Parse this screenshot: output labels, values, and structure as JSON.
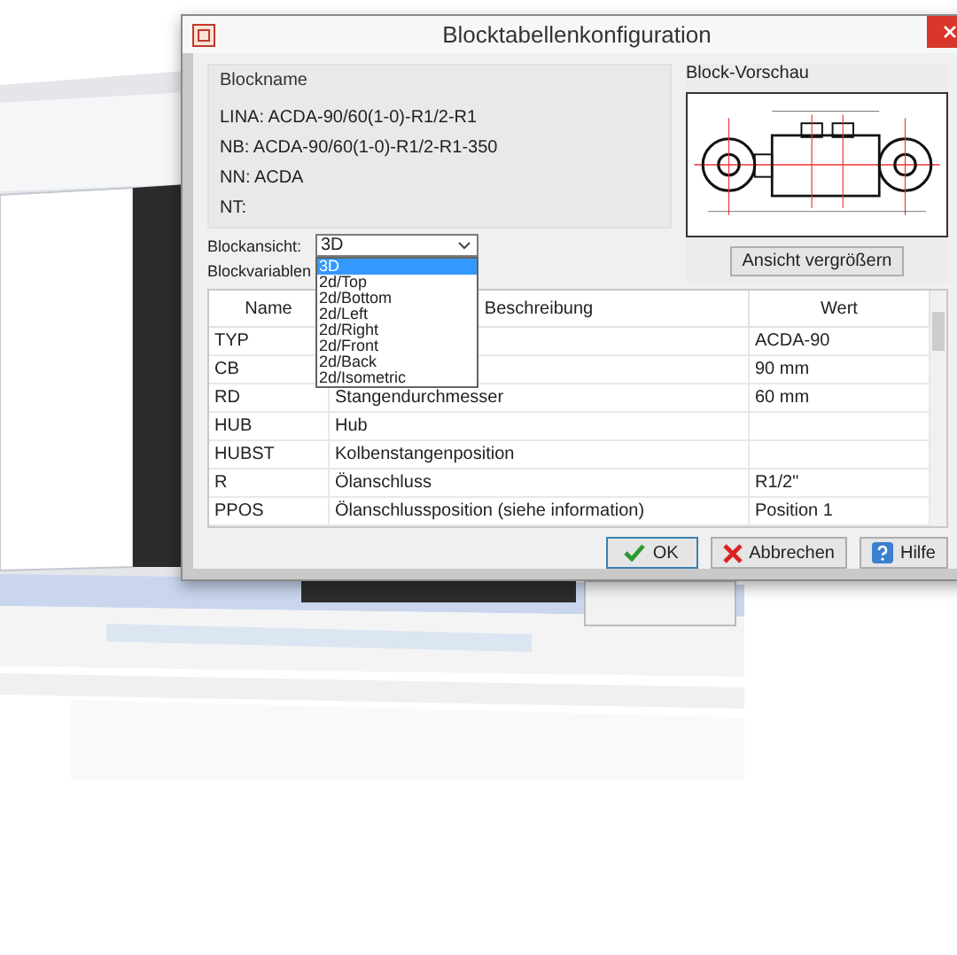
{
  "window": {
    "title": "Blocktabellenkonfiguration"
  },
  "blockname": {
    "title": "Blockname",
    "lines": [
      "LINA: ACDA-90/60(1-0)-R1/2-R1",
      "NB: ACDA-90/60(1-0)-R1/2-R1-350",
      "NN: ACDA",
      "NT:"
    ]
  },
  "preview": {
    "title": "Block-Vorschau",
    "enlarge_button": "Ansicht vergrößern"
  },
  "block_view": {
    "label": "Blockansicht:",
    "value": "3D",
    "options": [
      {
        "label": "3D",
        "selected": true
      },
      {
        "label": "2d/Top",
        "selected": false
      },
      {
        "label": "2d/Bottom",
        "selected": false
      },
      {
        "label": "2d/Left",
        "selected": false
      },
      {
        "label": "2d/Right",
        "selected": false
      },
      {
        "label": "2d/Front",
        "selected": false
      },
      {
        "label": "2d/Back",
        "selected": false
      },
      {
        "label": "2d/Isometric",
        "selected": false
      }
    ]
  },
  "variables": {
    "label": "Blockvariablen",
    "columns": [
      "Name",
      "Beschreibung",
      "Wert"
    ],
    "rows": [
      {
        "name": "TYP",
        "description": "",
        "value": "ACDA-90"
      },
      {
        "name": "CB",
        "description": "",
        "value": "90  mm"
      },
      {
        "name": "RD",
        "description": "Stangendurchmesser",
        "value": "60  mm"
      },
      {
        "name": "HUB",
        "description": "Hub",
        "value": ""
      },
      {
        "name": "HUBST",
        "description": "Kolbenstangenposition",
        "value": ""
      },
      {
        "name": "R",
        "description": "Ölanschluss",
        "value": "R1/2\""
      },
      {
        "name": "PPOS",
        "description": "Ölanschlussposition (siehe information)",
        "value": "Position 1"
      }
    ]
  },
  "buttons": [
    {
      "kind": "ok",
      "label": "OK"
    },
    {
      "kind": "cancel",
      "label": "Abbrechen"
    },
    {
      "kind": "help",
      "label": "Hilfe"
    }
  ]
}
